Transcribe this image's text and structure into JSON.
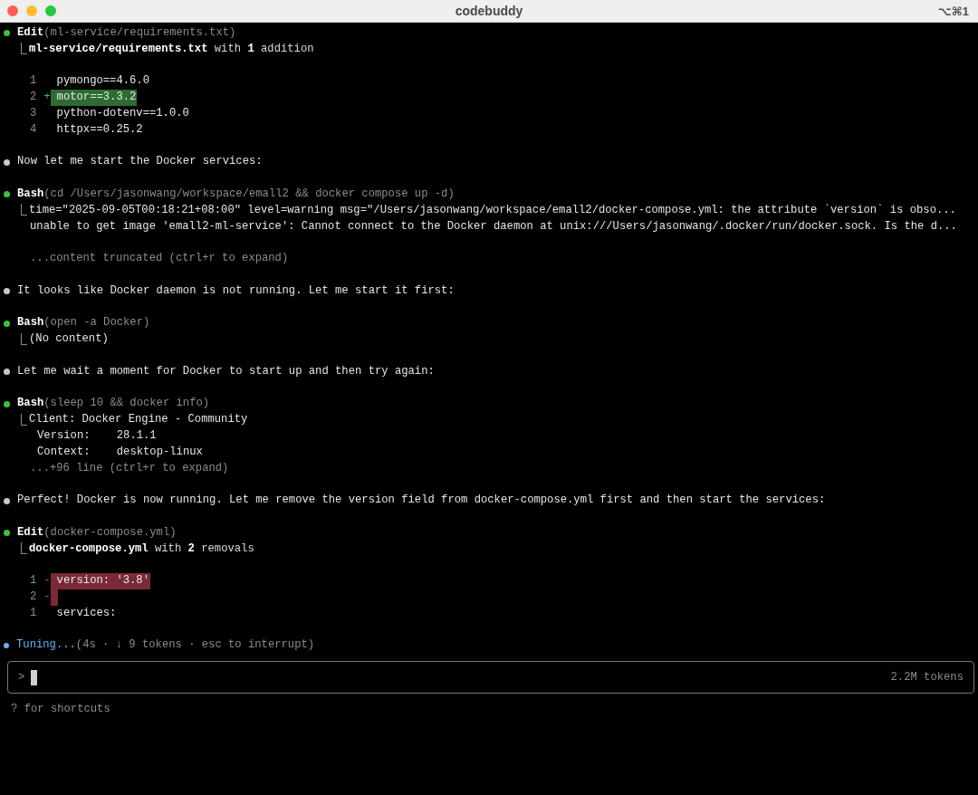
{
  "window": {
    "title": "codebuddy",
    "shortcut": "⌥⌘1"
  },
  "entries": [
    {
      "kind": "tool",
      "name": "Edit",
      "args": "(ml-service/requirements.txt)",
      "output": [
        {
          "kind": "summary",
          "text": "**ml-service/requirements.txt** with **1** addition"
        }
      ],
      "diff": [
        {
          "number": "1",
          "kind": "context",
          "text": "pymongo==4.6.0"
        },
        {
          "number": "2",
          "kind": "added",
          "sign": "+",
          "text": "motor==3.3.2"
        },
        {
          "number": "3",
          "kind": "context",
          "text": "python-dotenv==1.0.0"
        },
        {
          "number": "4",
          "kind": "context",
          "text": "httpx==0.25.2"
        }
      ]
    },
    {
      "kind": "message",
      "text": "Now let me start the Docker services:"
    },
    {
      "kind": "tool",
      "name": "Bash",
      "args": "(cd /Users/jasonwang/workspace/emall2 && docker compose up -d)",
      "output": [
        {
          "kind": "text",
          "text": "time=\"2025-09-05T00:18:21+08:00\" level=warning msg=\"/Users/jasonwang/workspace/emall2/docker-compose.yml: the attribute `version` is obso..."
        },
        {
          "kind": "text",
          "text": "unable to get image 'emall2-ml-service': Cannot connect to the Docker daemon at unix:///Users/jasonwang/.docker/run/docker.sock. Is the d..."
        },
        {
          "kind": "blank"
        },
        {
          "kind": "hint",
          "text": "...content truncated (ctrl+r to expand)"
        }
      ]
    },
    {
      "kind": "message",
      "text": "It looks like Docker daemon is not running. Let me start it first:"
    },
    {
      "kind": "tool",
      "name": "Bash",
      "args": "(open -a Docker)",
      "output": [
        {
          "kind": "text",
          "text": "(No content)"
        }
      ]
    },
    {
      "kind": "message",
      "text": "Let me wait a moment for Docker to start up and then try again:"
    },
    {
      "kind": "tool",
      "name": "Bash",
      "args": "(sleep 10 && docker info)",
      "output": [
        {
          "kind": "text",
          "text": "Client: Docker Engine - Community"
        },
        {
          "kind": "indented",
          "text": "Version:    28.1.1"
        },
        {
          "kind": "indented",
          "text": "Context:    desktop-linux"
        },
        {
          "kind": "hint",
          "text": "...+96 line (ctrl+r to expand)"
        }
      ]
    },
    {
      "kind": "message",
      "text": "Perfect! Docker is now running. Let me remove the version field from docker-compose.yml first and then start the services:"
    },
    {
      "kind": "tool",
      "name": "Edit",
      "args": "(docker-compose.yml)",
      "output": [
        {
          "kind": "summary",
          "text": "**docker-compose.yml** with **2** removals"
        }
      ],
      "diff": [
        {
          "number": "1",
          "kind": "removed",
          "sign": "-",
          "text": "version: '3.8'"
        },
        {
          "number": "2",
          "kind": "removed",
          "sign": "-"
        },
        {
          "number": "1",
          "kind": "context",
          "text": "services:"
        }
      ]
    },
    {
      "kind": "progress",
      "label": "Tuning...",
      "detail": "(4s · ↓ 9 tokens · esc to interrupt)"
    }
  ],
  "input": {
    "prompt": ">",
    "tokens": "2.2M tokens"
  },
  "footer": "? for shortcuts"
}
